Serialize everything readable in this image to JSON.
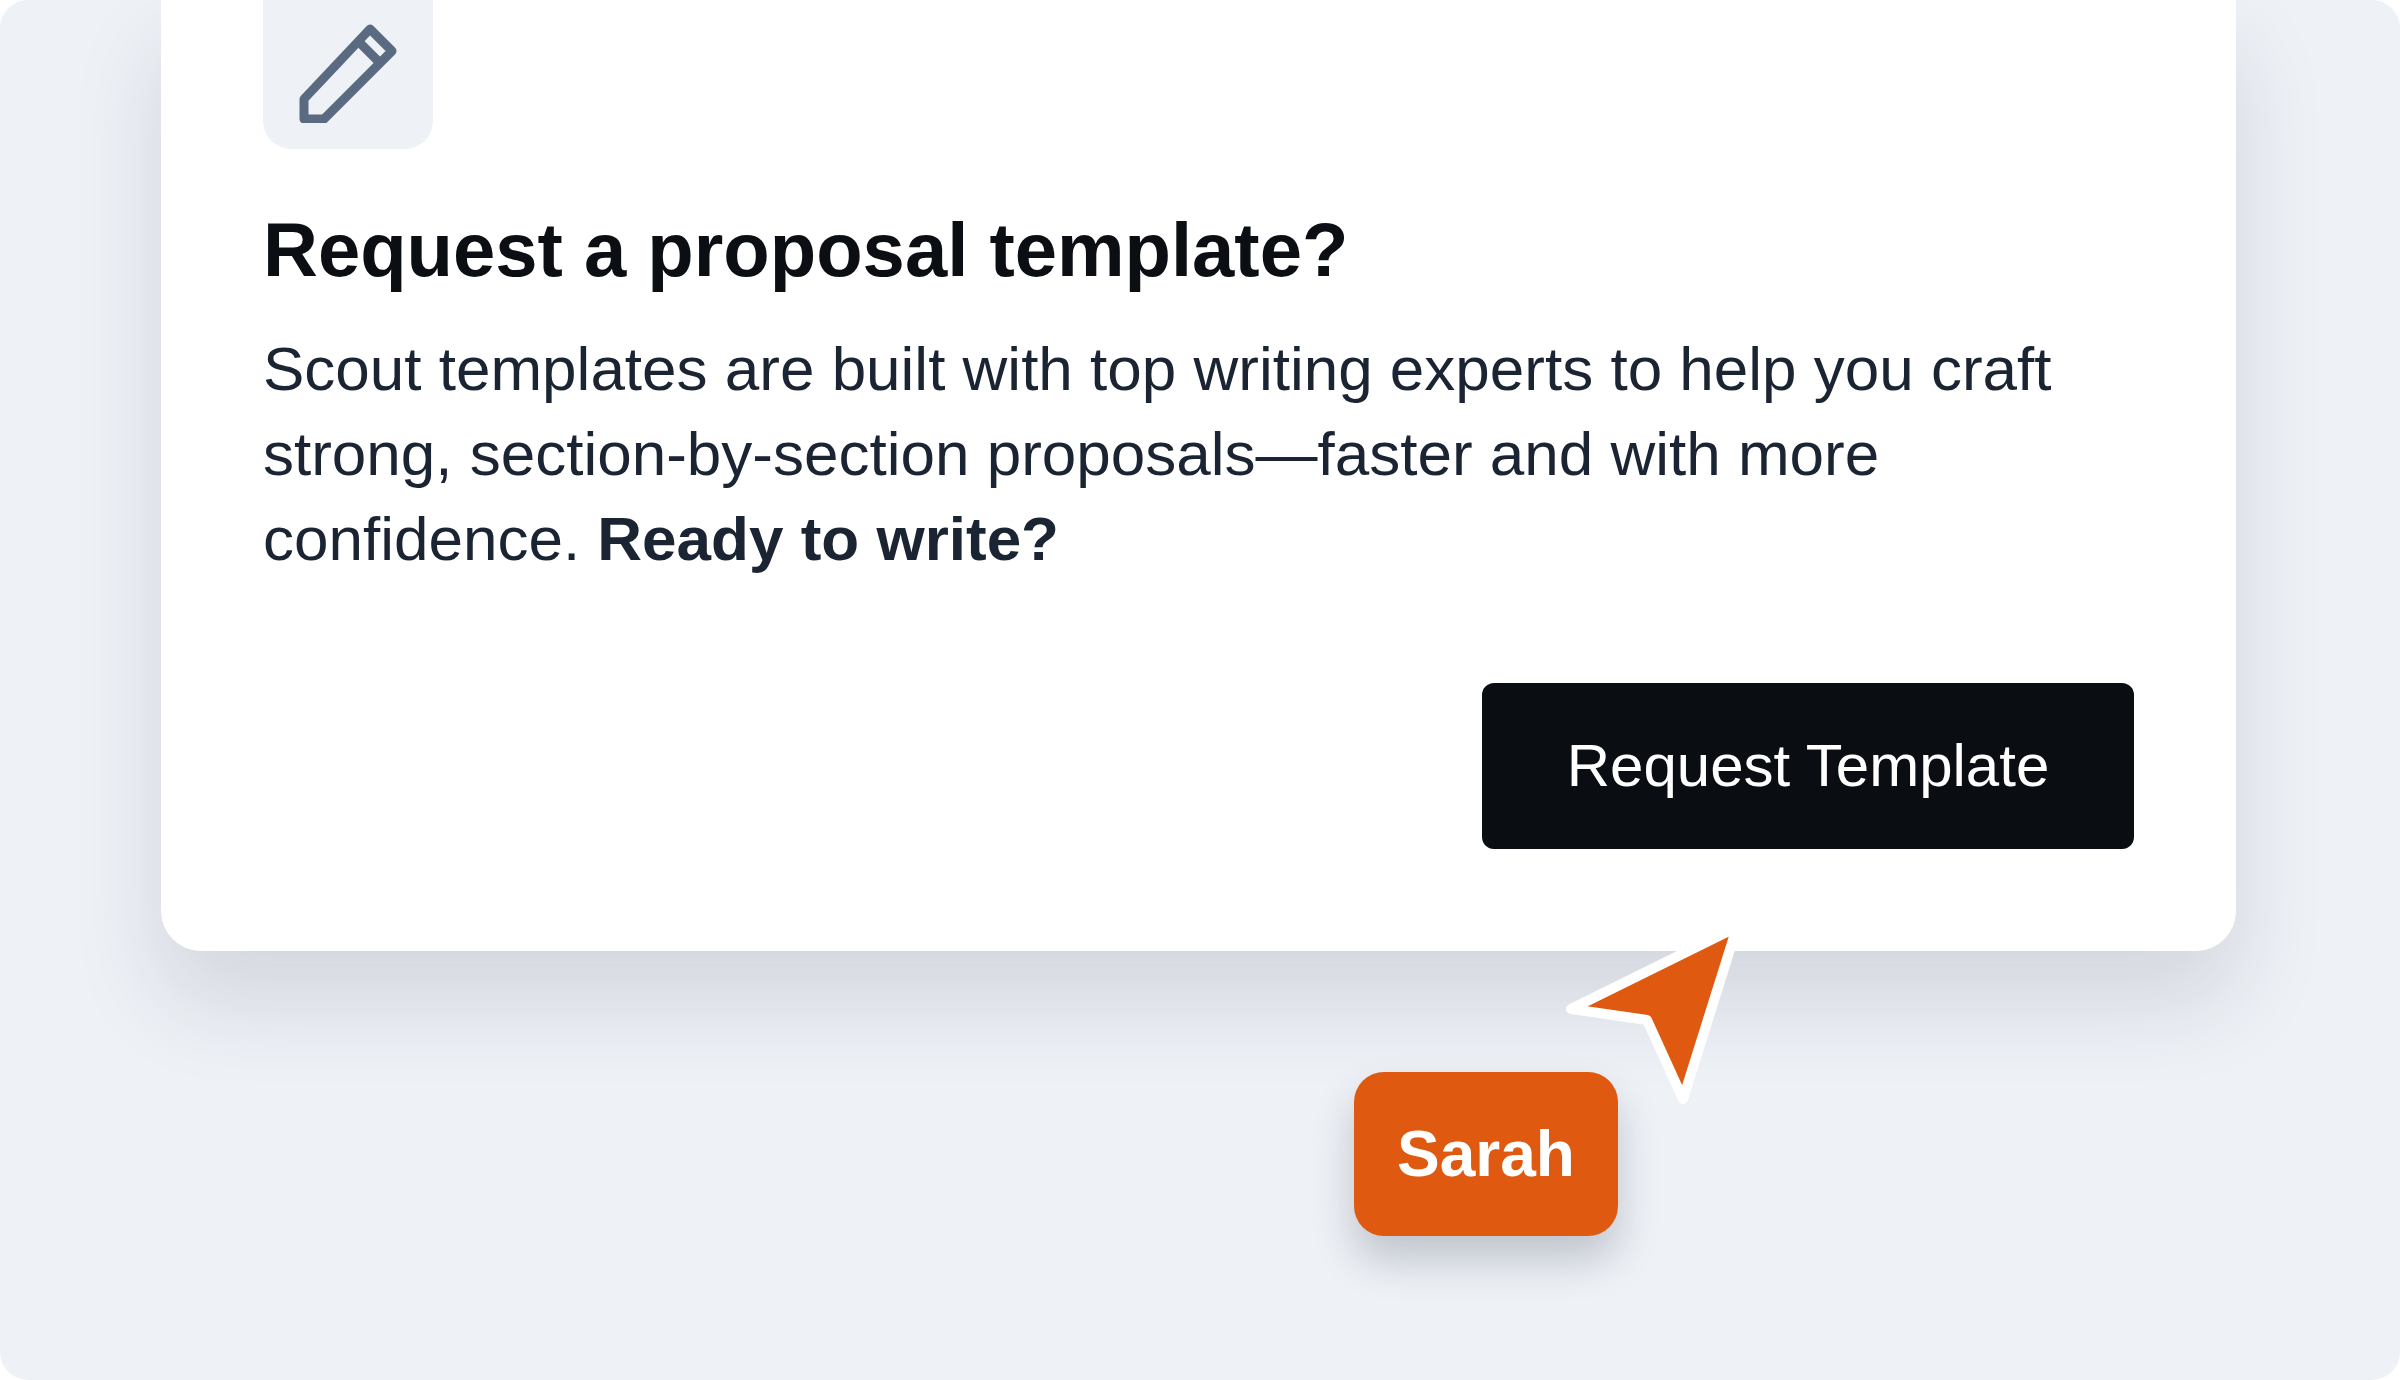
{
  "dialog": {
    "title": "Request a proposal template?",
    "body": "Scout templates are built with top writing experts to help you craft strong, section-by-section proposals—faster and with more confidence. **Ready to write?**",
    "button": "Request Template"
  },
  "cursor": {
    "label": "Sarah"
  }
}
